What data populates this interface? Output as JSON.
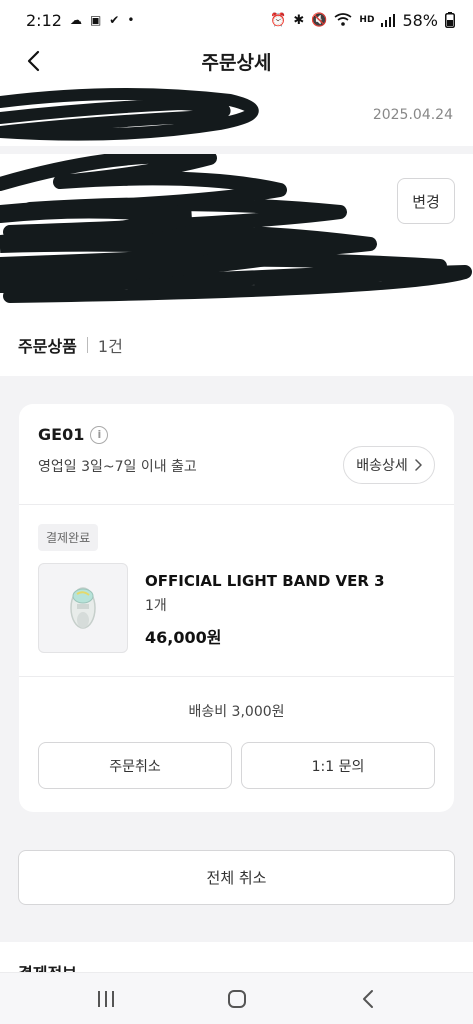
{
  "status_bar": {
    "time": "2:12",
    "battery": "58%",
    "icons_left": [
      "weather-icon",
      "calendar-icon",
      "check-icon",
      "dot-icon"
    ],
    "icons_right": [
      "alarm-icon",
      "bluetooth-icon",
      "mute-icon",
      "wifi-icon",
      "hd-voice-icon",
      "signal-icon"
    ]
  },
  "header": {
    "title": "주문상세"
  },
  "order": {
    "date": "2025.04.24",
    "change_label": "변경"
  },
  "items_section": {
    "title": "주문상품",
    "count": "1건"
  },
  "shipment": {
    "shipper": "GE01",
    "note": "영업일 3일~7일 이내 출고",
    "detail_label": "배송상세"
  },
  "product": {
    "status": "결제완료",
    "name": "OFFICIAL LIGHT BAND VER 3",
    "quantity": "1개",
    "price": "46,000원",
    "shipping_fee": "배송비 3,000원"
  },
  "actions": {
    "cancel_order": "주문취소",
    "inquiry": "1:1 문의",
    "cancel_all": "전체 취소"
  },
  "payment": {
    "title": "결제정보"
  },
  "colors": {
    "background": "#f3f3f5",
    "card": "#ffffff",
    "border": "#d6d6d8",
    "text": "#1a1a1a",
    "muted": "#888888"
  }
}
